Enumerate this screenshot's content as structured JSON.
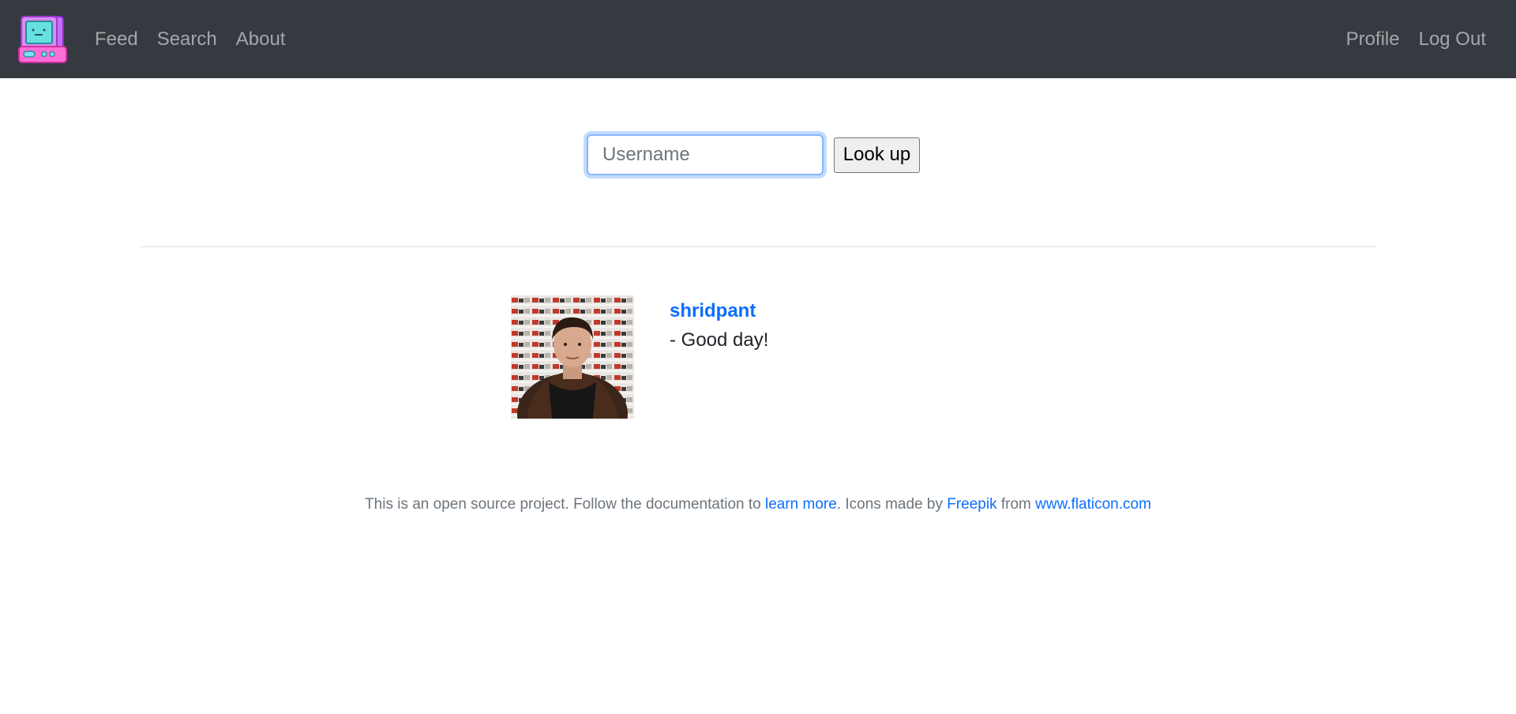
{
  "nav": {
    "left_items": [
      "Feed",
      "Search",
      "About"
    ],
    "right_items": [
      "Profile",
      "Log Out"
    ]
  },
  "search": {
    "placeholder": "Username",
    "button_label": "Look up"
  },
  "post": {
    "username": "shridpant",
    "text": "- Good day!"
  },
  "footer": {
    "text_before": "This is an open source project. Follow the documentation to ",
    "learn_more": "learn more",
    "text_middle": ". Icons made by ",
    "freepik": "Freepik",
    "text_from": " from ",
    "flaticon": "www.flaticon.com"
  },
  "colors": {
    "navbar_bg": "#343a40",
    "link_blue": "#0d6efd",
    "muted": "#6c757d"
  }
}
